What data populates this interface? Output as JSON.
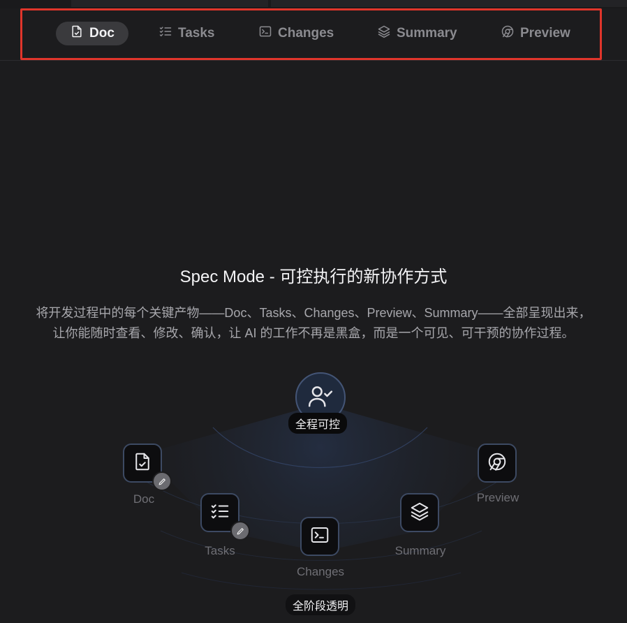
{
  "tabs": [
    {
      "label": "Doc",
      "icon": "doc-check-icon",
      "active": true
    },
    {
      "label": "Tasks",
      "icon": "checklist-icon",
      "active": false
    },
    {
      "label": "Changes",
      "icon": "terminal-icon",
      "active": false
    },
    {
      "label": "Summary",
      "icon": "layers-icon",
      "active": false
    },
    {
      "label": "Preview",
      "icon": "chrome-icon",
      "active": false
    }
  ],
  "hero": {
    "title": "Spec Mode - 可控执行的新协作方式",
    "desc_line1": "将开发过程中的每个关键产物——Doc、Tasks、Changes、Preview、Summary——全部呈现出来，",
    "desc_line2": "让你能随时查看、修改、确认，让 AI 的工作不再是黑盒，而是一个可见、可干预的协作过程。"
  },
  "diagram": {
    "center_label": "全程可控",
    "bottom_label": "全阶段透明",
    "nodes": [
      {
        "label": "Doc",
        "icon": "doc-check-icon",
        "editable": true
      },
      {
        "label": "Tasks",
        "icon": "checklist-icon",
        "editable": true
      },
      {
        "label": "Changes",
        "icon": "terminal-icon",
        "editable": false
      },
      {
        "label": "Summary",
        "icon": "layers-icon",
        "editable": false
      },
      {
        "label": "Preview",
        "icon": "chrome-icon",
        "editable": false
      }
    ]
  },
  "colors": {
    "background": "#1c1c1e",
    "highlight": "#e0352b",
    "node_border": "#3d4a63",
    "active_tab": "#3a3a3d"
  }
}
